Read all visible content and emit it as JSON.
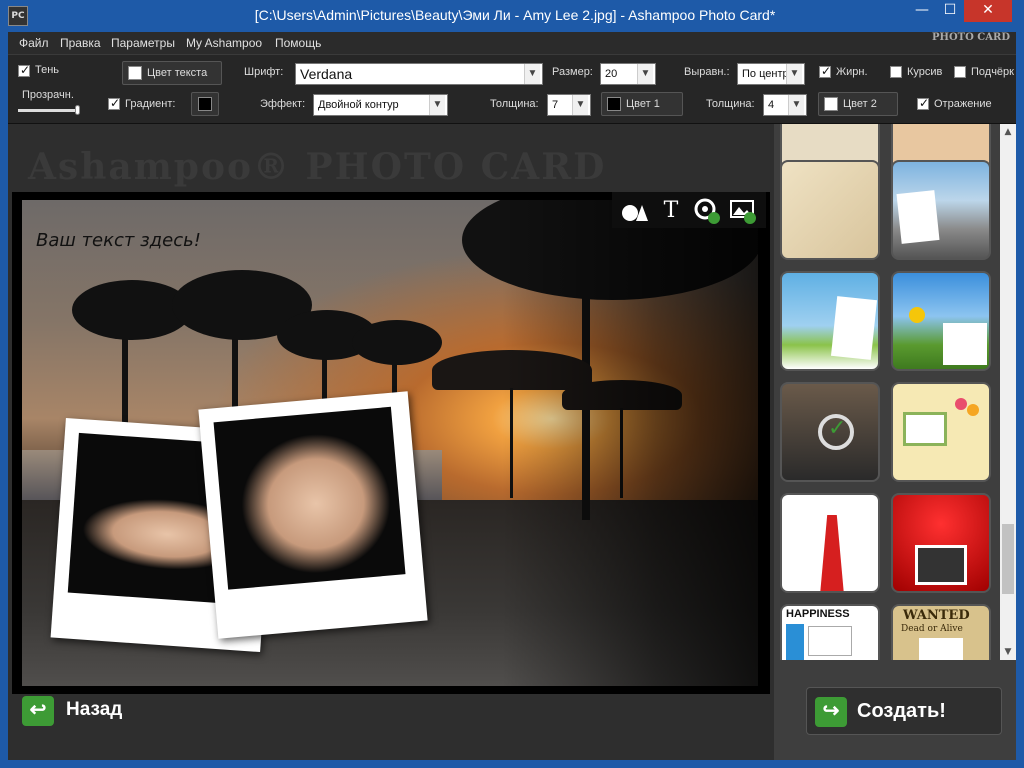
{
  "window": {
    "title": "[C:\\Users\\Admin\\Pictures\\Beauty\\Эми Ли - Amy Lee 2.jpg] - Ashampoo Photo Card*",
    "app_icon_text": "PC",
    "minimize": "—",
    "maximize": "☐",
    "close": "✕"
  },
  "menu": {
    "items": [
      "Файл",
      "Правка",
      "Параметры",
      "My Ashampoo",
      "Помощь"
    ],
    "logo": "PHOTO CARD"
  },
  "toolbar": {
    "shadow": {
      "label": "Тень",
      "checked": true
    },
    "transparency_label": "Прозрачн.",
    "transparency_value": 0.9,
    "gradient": {
      "label": "Градиент:",
      "checked": true,
      "color": "#000000"
    },
    "text_color_button": {
      "label": "Цвет текста",
      "color": "#ffffff"
    },
    "font": {
      "label": "Шрифт:",
      "value": "Verdana"
    },
    "effect": {
      "label": "Эффект:",
      "value": "Двойной контур"
    },
    "size": {
      "label": "Размер:",
      "value": "20"
    },
    "thickness1": {
      "label": "Толщина:",
      "value": "7"
    },
    "color1_button": {
      "label": "Цвет 1",
      "color": "#000000"
    },
    "align": {
      "label": "Выравн.:",
      "value": "По центру"
    },
    "thickness2": {
      "label": "Толщина:",
      "value": "4"
    },
    "color2_button": {
      "label": "Цвет 2",
      "color": "#ffffff"
    },
    "bold": {
      "label": "Жирн.",
      "checked": true
    },
    "italic": {
      "label": "Курсив",
      "checked": false
    },
    "underline": {
      "label": "Подчёрк",
      "checked": false
    },
    "reflection": {
      "label": "Отражение",
      "checked": true
    }
  },
  "canvas": {
    "watermark": "Ashampoo® PHOTO CARD",
    "caption_text": "Ваш текст здесь!",
    "frame_tools": [
      "shapes-icon",
      "text-icon",
      "sticker-icon",
      "image-replace-icon"
    ],
    "text_tool_glyph": "T"
  },
  "templates": {
    "thumbnails": [
      {
        "name": "template-old-paper",
        "colors": [
          "#e8d9b8",
          "#cdb88e"
        ]
      },
      {
        "name": "template-route-66",
        "colors": [
          "#7db3e0",
          "#8a8a8a"
        ]
      },
      {
        "name": "template-palm-beach",
        "colors": [
          "#6fb7e0",
          "#8bc34a"
        ]
      },
      {
        "name": "template-sunflowers",
        "colors": [
          "#3b8fdc",
          "#f5c60a"
        ]
      },
      {
        "name": "template-current-selected",
        "colors": [
          "#6a5a4a",
          "#2a2a2a"
        ]
      },
      {
        "name": "template-thank-you",
        "colors": [
          "#f6e9b4",
          "#e0c97a"
        ]
      },
      {
        "name": "template-red-carpet",
        "colors": [
          "#ffffff",
          "#d61f1f"
        ]
      },
      {
        "name": "template-retro-tv",
        "colors": [
          "#d80f0f",
          "#3a0000"
        ]
      },
      {
        "name": "template-happiness-words",
        "colors": [
          "#ffffff",
          "#111111"
        ]
      },
      {
        "name": "template-wanted",
        "colors": [
          "#d8c28c",
          "#6a4a1a"
        ]
      }
    ],
    "wanted_text": "WANTED",
    "wanted_sub": "Dead or Alive",
    "happiness_text": "HAPPINESS"
  },
  "buttons": {
    "back": "Назад",
    "create": "Создать!"
  }
}
